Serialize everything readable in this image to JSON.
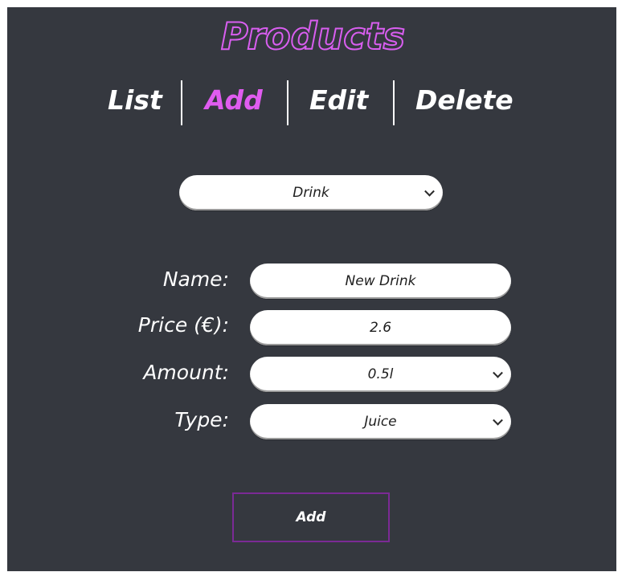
{
  "header": {
    "title": "Products"
  },
  "tabs": [
    {
      "label": "List",
      "active": false
    },
    {
      "label": "Add",
      "active": true
    },
    {
      "label": "Edit",
      "active": false
    },
    {
      "label": "Delete",
      "active": false
    }
  ],
  "category_select": {
    "value": "Drink"
  },
  "form": {
    "name": {
      "label": "Name:",
      "value": "New Drink"
    },
    "price": {
      "label": "Price (€):",
      "value": "2.6"
    },
    "amount": {
      "label": "Amount:",
      "value": "0.5l"
    },
    "type": {
      "label": "Type:",
      "value": "Juice"
    }
  },
  "submit": {
    "label": "Add"
  },
  "colors": {
    "background": "#35383f",
    "accent": "#e05cf0",
    "button_border": "#7b2a95",
    "text": "#ffffff"
  }
}
